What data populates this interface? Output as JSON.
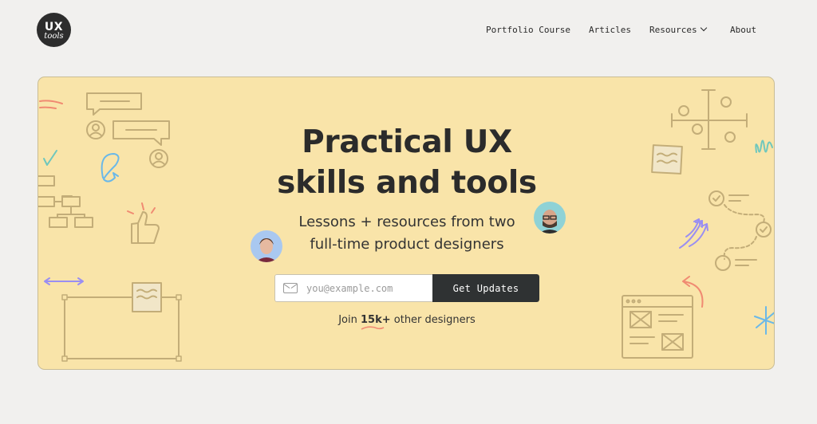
{
  "header": {
    "logo": {
      "line1": "UX",
      "line2": "tools"
    },
    "nav": [
      {
        "label": "Portfolio Course"
      },
      {
        "label": "Articles"
      },
      {
        "label": "Resources"
      },
      {
        "label": "About"
      }
    ]
  },
  "hero": {
    "title_line1": "Practical UX",
    "title_line2": "skills and tools",
    "subtitle_line1": "Lessons + resources from two",
    "subtitle_line2": "full-time product designers",
    "email_placeholder": "you@example.com",
    "email_value": "",
    "cta_label": "Get Updates",
    "join_prefix": "Join",
    "join_count": "15k+",
    "join_suffix": "other designers"
  },
  "colors": {
    "page_bg": "#f1f0ee",
    "hero_bg": "#f9e4a9",
    "doodle_stroke": "#c3ad78",
    "button_bg": "#2f3233",
    "accent_purple": "#9a8ef2",
    "accent_coral": "#f08a72",
    "accent_teal": "#6fc7bd",
    "accent_blue": "#6ab8e8"
  },
  "icons": [
    "mail-icon",
    "chevron-down-icon",
    "chat-bubble-icon",
    "user-icon",
    "thumbs-up-icon",
    "flowchart-icon",
    "sticky-note-icon",
    "checkmark-icon",
    "arrows-icon",
    "browser-window-icon"
  ]
}
